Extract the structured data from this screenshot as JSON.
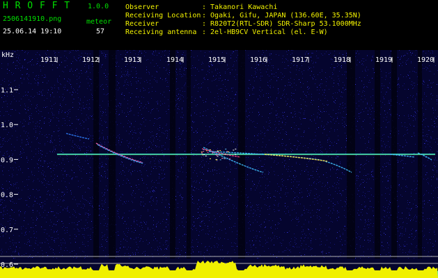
{
  "app": {
    "name": "H R O F F T",
    "version": "1.0.0"
  },
  "capture": {
    "filename": "2506141910.png",
    "timestamp": "25.06.14 19:10",
    "count_label": "meteor",
    "count_value": "57"
  },
  "info": {
    "labels": [
      "Observer",
      "Receiving Location",
      "Receiver",
      "Receiving antenna"
    ],
    "values": [
      ": Takanori Kawachi",
      ": Ogaki, Gifu, JAPAN (136.60E, 35.35N)",
      ": R820T2(RTL-SDR) SDR-Sharp 53.1000MHz",
      ": 2el-HB9CV Vertical (el. E-W)"
    ]
  },
  "y_axis": {
    "unit": "kHz",
    "ticks": [
      "1.1",
      "1.0",
      "0.9",
      "0.8",
      "0.7",
      "0.6"
    ]
  },
  "x_axis": {
    "ticks": [
      "1911",
      "1912",
      "1913",
      "1914",
      "1915",
      "1916",
      "1917",
      "1918",
      "1919",
      "1920"
    ]
  },
  "colors": {
    "background": "#000000",
    "noise": "#16167a",
    "carrier": "#38e8c8",
    "header_green": "#00e000",
    "header_yellow": "#f4f400",
    "histogram_cyan": "#00e8ff",
    "histogram_yellow": "#f0f000"
  }
}
